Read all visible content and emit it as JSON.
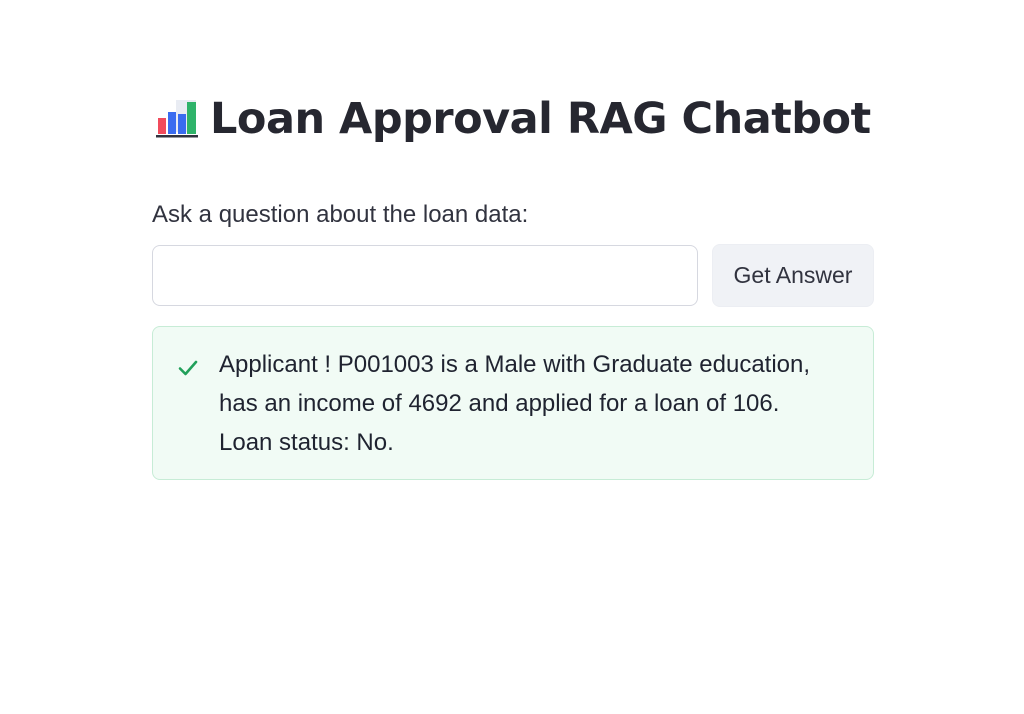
{
  "header": {
    "icon": "bar-chart-icon",
    "title": "Loan Approval RAG Chatbot"
  },
  "query": {
    "label": "Ask a question about the loan data:",
    "value": "",
    "placeholder": ""
  },
  "actions": {
    "get_answer_label": "Get Answer"
  },
  "result": {
    "icon": "check-icon",
    "lines": [
      "Applicant ! P001003 is a Male with Graduate education,",
      "has an income of 4692 and applied for a loan of 106.",
      "Loan status: No."
    ]
  },
  "colors": {
    "success_bg": "#f1fbf5",
    "success_border": "#c7ecd6",
    "success_check": "#21a05a",
    "button_bg": "#f0f2f6",
    "text": "#31333f"
  }
}
